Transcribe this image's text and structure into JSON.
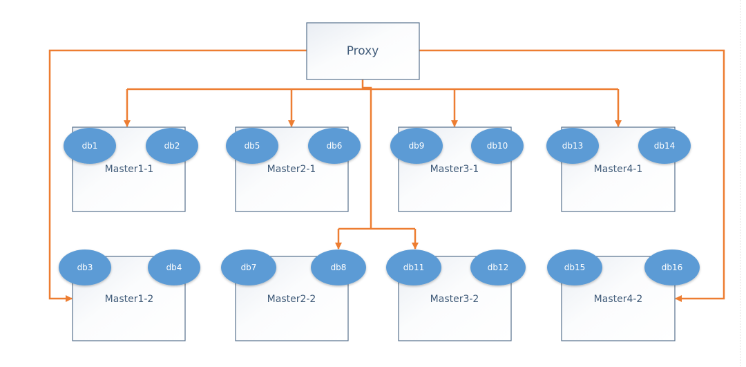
{
  "diagram": {
    "proxy": {
      "label": "Proxy"
    },
    "masters": [
      {
        "label": "Master1-1",
        "dbs": [
          "db1",
          "db2"
        ]
      },
      {
        "label": "Master2-1",
        "dbs": [
          "db5",
          "db6"
        ]
      },
      {
        "label": "Master3-1",
        "dbs": [
          "db9",
          "db10"
        ]
      },
      {
        "label": "Master4-1",
        "dbs": [
          "db13",
          "db14"
        ]
      },
      {
        "label": "Master1-2",
        "dbs": [
          "db3",
          "db4"
        ]
      },
      {
        "label": "Master2-2",
        "dbs": [
          "db7",
          "db8"
        ]
      },
      {
        "label": "Master3-2",
        "dbs": [
          "db11",
          "db12"
        ]
      },
      {
        "label": "Master4-2",
        "dbs": [
          "db15",
          "db16"
        ]
      }
    ],
    "colors": {
      "connector": "#ed7d31",
      "db": "#5b9bd5",
      "box_border": "#56708c",
      "text": "#3f5a78"
    }
  }
}
